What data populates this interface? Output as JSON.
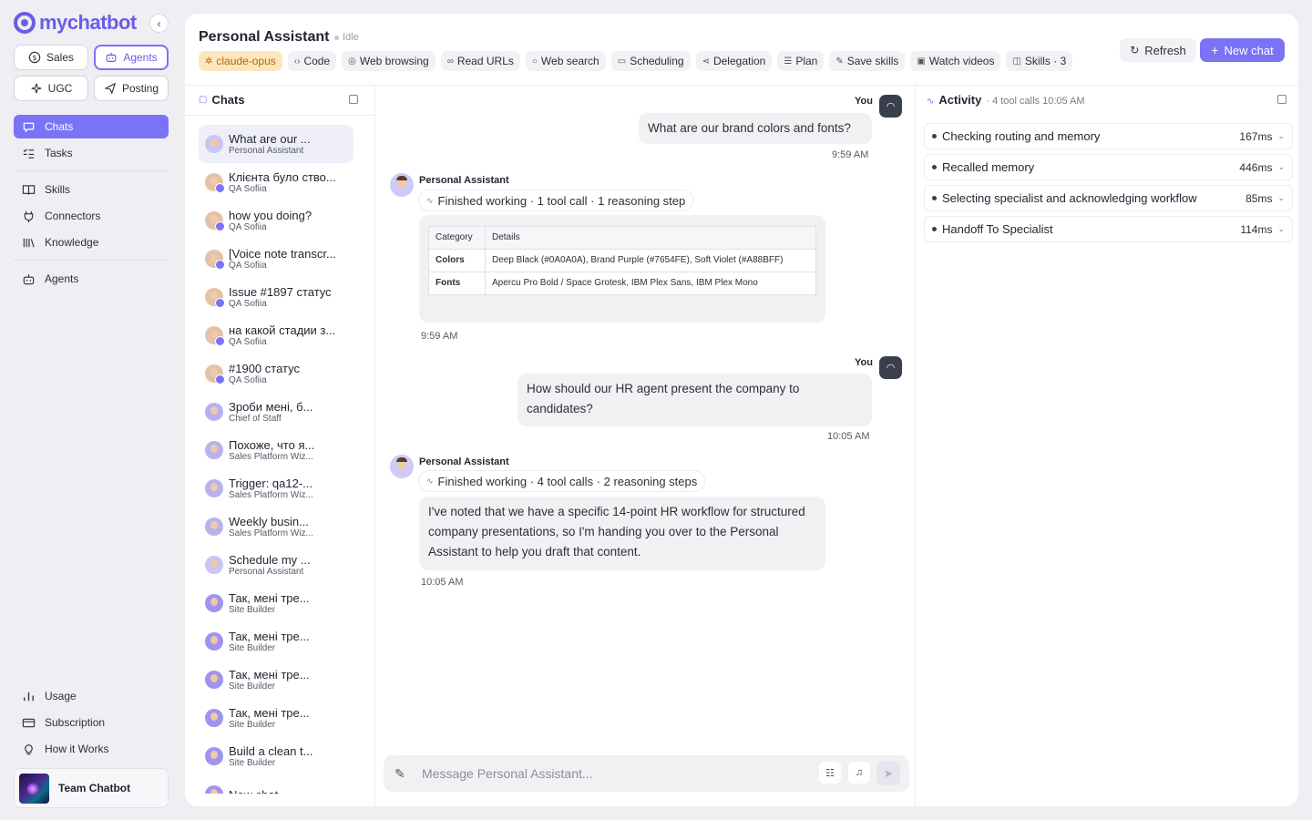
{
  "brand": {
    "name": "mychatbot"
  },
  "modes": [
    {
      "label": "Sales",
      "icon": "dollar-icon"
    },
    {
      "label": "Agents",
      "icon": "robot-icon"
    },
    {
      "label": "UGC",
      "icon": "sparkle-icon"
    },
    {
      "label": "Posting",
      "icon": "send-icon"
    }
  ],
  "nav": {
    "chats": "Chats",
    "tasks": "Tasks",
    "skills": "Skills",
    "connectors": "Connectors",
    "knowledge": "Knowledge",
    "agents": "Agents",
    "usage": "Usage",
    "subscription": "Subscription",
    "how_it_works": "How it Works"
  },
  "team": {
    "name": "Team Chatbot"
  },
  "header": {
    "title": "Personal Assistant",
    "status": "Idle",
    "model": "claude-opus",
    "capabilities": [
      "Code",
      "Web browsing",
      "Read URLs",
      "Web search",
      "Scheduling",
      "Delegation",
      "Plan",
      "Save skills",
      "Watch videos",
      "Skills · 3"
    ],
    "refresh_label": "Refresh",
    "new_chat_label": "New chat"
  },
  "chats": {
    "heading": "Chats",
    "items": [
      {
        "title": "What are our ...",
        "subtitle": "Personal Assistant",
        "avatar": "pa"
      },
      {
        "title": "Клієнта було ство...",
        "subtitle": "QA Sofiia",
        "avatar": "qa"
      },
      {
        "title": "how you doing?",
        "subtitle": "QA Sofiia",
        "avatar": "qa"
      },
      {
        "title": "[Voice note transcr...",
        "subtitle": "QA Sofiia",
        "avatar": "qa"
      },
      {
        "title": "Issue #1897 статус",
        "subtitle": "QA Sofiia",
        "avatar": "qa"
      },
      {
        "title": "на какой стадии з...",
        "subtitle": "QA Sofiia",
        "avatar": "qa"
      },
      {
        "title": "#1900 статус",
        "subtitle": "QA Sofiia",
        "avatar": "qa"
      },
      {
        "title": "Зроби мені, б...",
        "subtitle": "Chief of Staff",
        "avatar": "cs"
      },
      {
        "title": "Похоже, что я...",
        "subtitle": "Sales Platform Wiz...",
        "avatar": "sp"
      },
      {
        "title": "Trigger: qa12-...",
        "subtitle": "Sales Platform Wiz...",
        "avatar": "sp"
      },
      {
        "title": "Weekly busin...",
        "subtitle": "Sales Platform Wiz...",
        "avatar": "sp"
      },
      {
        "title": "Schedule my ...",
        "subtitle": "Personal Assistant",
        "avatar": "pa"
      },
      {
        "title": "Так, мені тре...",
        "subtitle": "Site Builder",
        "avatar": "sb"
      },
      {
        "title": "Так, мені тре...",
        "subtitle": "Site Builder",
        "avatar": "sb"
      },
      {
        "title": "Так, мені тре...",
        "subtitle": "Site Builder",
        "avatar": "sb"
      },
      {
        "title": "Так, мені тре...",
        "subtitle": "Site Builder",
        "avatar": "sb"
      },
      {
        "title": "Build a clean t...",
        "subtitle": "Site Builder",
        "avatar": "sb"
      },
      {
        "title": "New chat",
        "subtitle": "",
        "avatar": "sb"
      }
    ]
  },
  "conversation": {
    "you_label": "You",
    "bot_name": "Personal Assistant",
    "msg1": {
      "text": "What are our brand colors and fonts?",
      "time": "9:59 AM"
    },
    "reply1": {
      "work": "Finished working · 1 tool call · 1 reasoning step",
      "table_headers": [
        "Category",
        "Details"
      ],
      "rows": [
        {
          "key": "Colors",
          "value": "Deep Black (#0A0A0A), Brand Purple (#7654FE), Soft Violet (#A88BFF)"
        },
        {
          "key": "Fonts",
          "value": "Apercu Pro Bold / Space Grotesk, IBM Plex Sans, IBM Plex Mono"
        }
      ],
      "time": "9:59 AM"
    },
    "msg2": {
      "text": "How should our HR agent present the company to candidates?",
      "time": "10:05 AM"
    },
    "reply2": {
      "work": "Finished working · 4 tool calls · 2 reasoning steps",
      "text": "I've noted that we have a specific 14-point HR workflow for structured company presentations, so I'm handing you over to the Personal Assistant to help you draft that content.",
      "time": "10:05 AM"
    },
    "composer_placeholder": "Message Personal Assistant..."
  },
  "activity": {
    "title": "Activity",
    "meta": "· 4 tool calls  10:05 AM",
    "items": [
      {
        "label": "Checking routing and memory",
        "ms": "167ms"
      },
      {
        "label": "Recalled memory",
        "ms": "446ms"
      },
      {
        "label": "Selecting specialist and acknowledging workflow",
        "ms": "85ms"
      },
      {
        "label": "Handoff To Specialist",
        "ms": "114ms"
      }
    ]
  },
  "colors": {
    "accent": "#7B73F6",
    "model_chip_bg": "#FDE6BD",
    "user_avatar": "#3A3F4E"
  }
}
